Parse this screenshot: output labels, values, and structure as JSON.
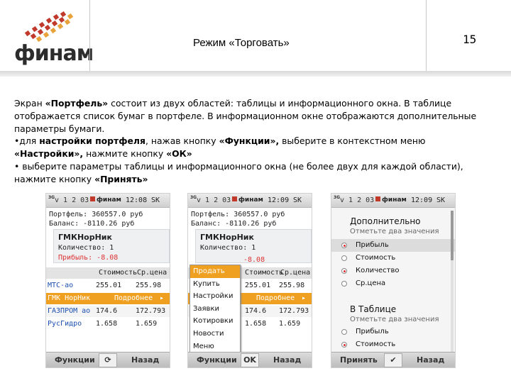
{
  "header": {
    "logo_text": "финам",
    "title": "Режим «Торговать»",
    "page_number": "15"
  },
  "body": {
    "p1_a": "Экран ",
    "p1_b": "«Портфель»",
    "p1_c": " состоит из двух областей: таблицы и информационного окна. В таблице отображается список бумаг в портфеле. В информационном окне отображаются дополнительные параметры бумаги.",
    "b1_a": "•для ",
    "b1_b": "настройки портфеля",
    "b1_c": ", нажав кнопку ",
    "b1_d": "«Функции»,",
    "b1_e": " выберите в контекстном меню ",
    "b1_f": "«Настройки»,",
    "b1_g": " нажмите кнопку ",
    "b1_h": "«ОК»",
    "b2_a": "• выберите параметры таблицы и информационного окна (не более двух для каждой области), нажмите кнопку ",
    "b2_b": "«Принять»"
  },
  "phone_common": {
    "network": "3G",
    "version": "v 1 2 03",
    "brand": "финам",
    "sk": "SK"
  },
  "phone1": {
    "time": "12:08",
    "portfolio": "Портфель: 360557.0 руб",
    "balance": "Баланс: -8110.26 руб",
    "card_name": "ГМКНорНик",
    "card_qty": "Количество: 1",
    "card_profit": "Прибыль: -8.08",
    "col1": "Стоимость",
    "col2": "Ср.цена",
    "rows": [
      {
        "name": "МТС-ао",
        "v1": "255.01",
        "v2": "255.98"
      },
      {
        "name": "ГМК НорНик",
        "v1": "Подробнее",
        "v2": ""
      },
      {
        "name": "ГАЗПРОМ ао",
        "v1": "174.6",
        "v2": "172.793"
      },
      {
        "name": "РусГидро",
        "v1": "1.658",
        "v2": "1.659"
      }
    ],
    "soft_left": "Функции",
    "soft_mid": "⟳",
    "soft_right": "Назад"
  },
  "phone2": {
    "time": "12:09",
    "portfolio": "Портфель: 360557.0 руб",
    "balance": "Баланс: -8110.26 руб",
    "card_name": "ГМКНорНик",
    "card_qty": "Количество: 1",
    "card_profit": "-8.08",
    "col1": "Стоимость",
    "col2": "Ср.цена",
    "rows": [
      {
        "v1": "255.01",
        "v2": "255.98"
      },
      {
        "v1": "Подробнее",
        "v2": ""
      },
      {
        "v1": "174.6",
        "v2": "172.793"
      },
      {
        "v1": "1.658",
        "v2": "1.659"
      }
    ],
    "menu": [
      "Продать",
      "Купить",
      "Настройки",
      "Заявки",
      "Котировки",
      "Новости",
      "Меню"
    ],
    "soft_left": "Функции",
    "soft_mid": "OK",
    "soft_right": "Назад"
  },
  "phone3": {
    "time": "12:09",
    "h1": "Дополнительно",
    "s1": "Отметьте два значения",
    "opts1": [
      "Прибыль",
      "Стоимость",
      "Количество",
      "Ср.цена"
    ],
    "h2": "В Таблице",
    "s2": "Отметьте два значения",
    "opts2": [
      "Прибыль",
      "Стоимость"
    ],
    "soft_left": "Принять",
    "soft_mid": "✔",
    "soft_right": "Назад"
  },
  "colors": {
    "accent": "#f0a020",
    "logo_red": "#c0392b",
    "negative": "#dd3333"
  }
}
